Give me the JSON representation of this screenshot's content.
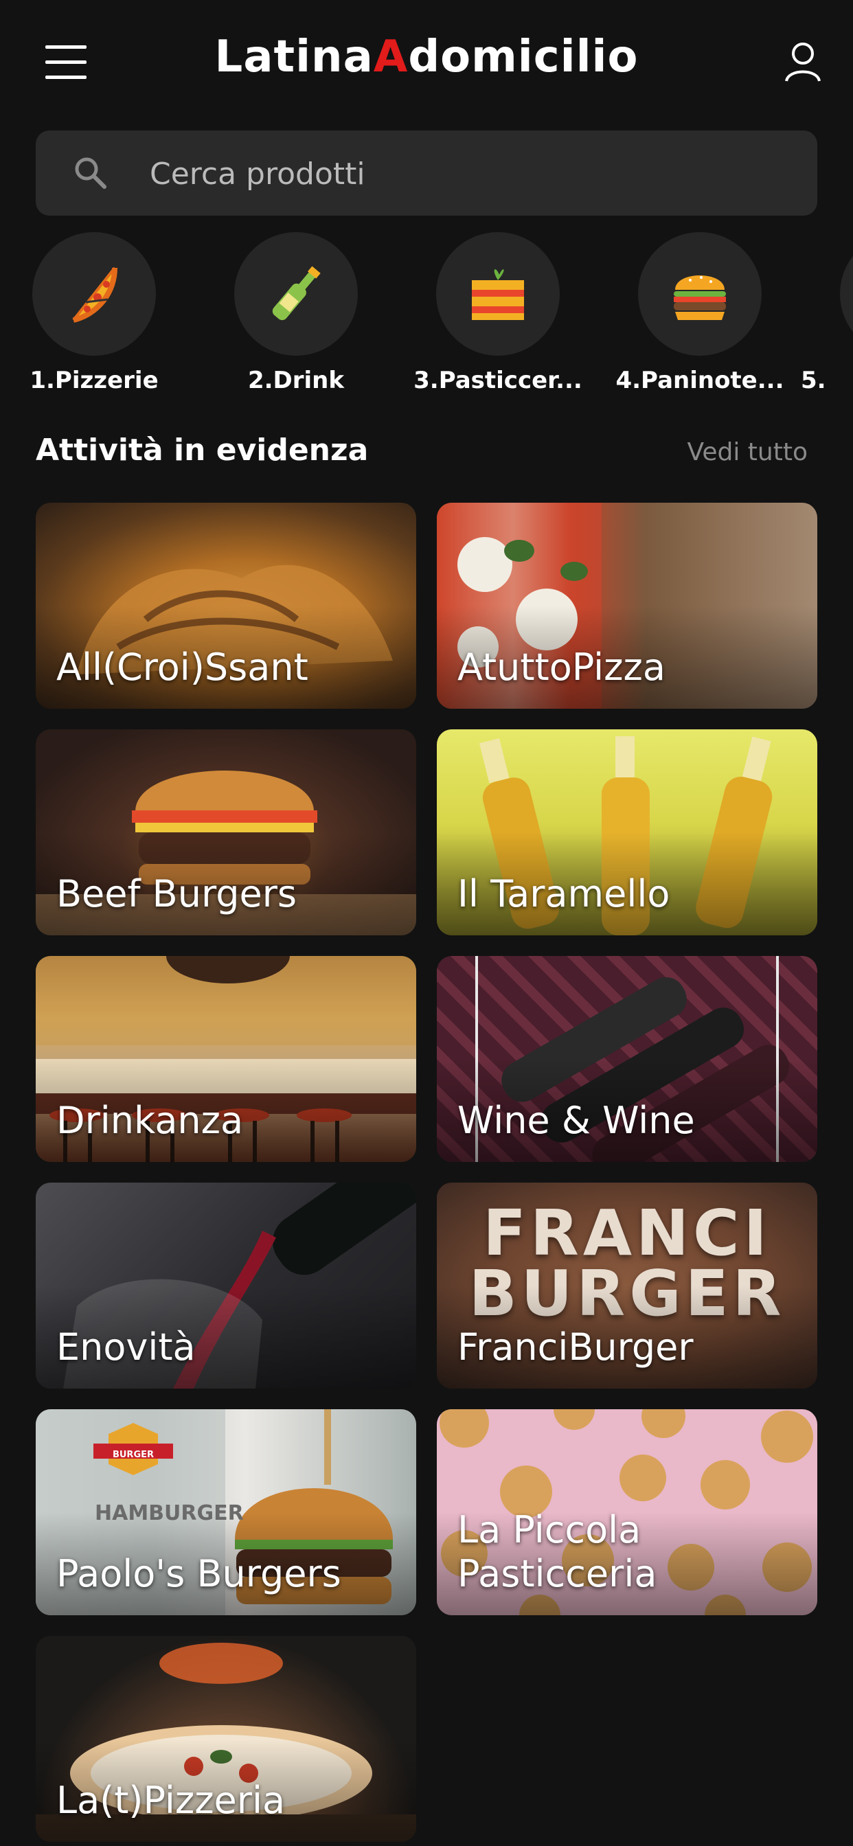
{
  "header": {
    "logo": {
      "part1": "Latina",
      "part2": "A",
      "part3": "domicilio"
    }
  },
  "search": {
    "placeholder": "Cerca prodotti"
  },
  "categories": [
    {
      "label": "1.Pizzerie",
      "icon": "pizza-icon"
    },
    {
      "label": "2.Drink",
      "icon": "bottle-icon"
    },
    {
      "label": "3.Pasticcer...",
      "icon": "lasagna-icon"
    },
    {
      "label": "4.Paninote...",
      "icon": "burger-icon"
    },
    {
      "label": "5.",
      "icon": "category-icon"
    }
  ],
  "featured": {
    "title": "Attività in evidenza",
    "see_all": "Vedi tutto",
    "items": [
      {
        "name": "All(Croi)Ssant"
      },
      {
        "name": "AtuttoPizza"
      },
      {
        "name": "Beef Burgers"
      },
      {
        "name": "Il Taramello"
      },
      {
        "name": "Drinkanza"
      },
      {
        "name": "Wine & Wine"
      },
      {
        "name": "Enovità"
      },
      {
        "name": "FranciBurger"
      },
      {
        "name": "Paolo's Burgers"
      },
      {
        "name": "La Piccola Pasticceria"
      },
      {
        "name": "La(t)Pizzeria"
      }
    ],
    "image_text": {
      "franciburger_line1": "FRANCI",
      "franciburger_line2": "BURGER",
      "paolos_badge": "BURGER",
      "paolos_text": "HAMBURGER"
    }
  },
  "colors": {
    "background": "#121212",
    "search_bg": "#2a2a2a",
    "circle_bg": "#262626",
    "logo_accent": "#e21b1b",
    "muted": "#8a8a8a"
  }
}
